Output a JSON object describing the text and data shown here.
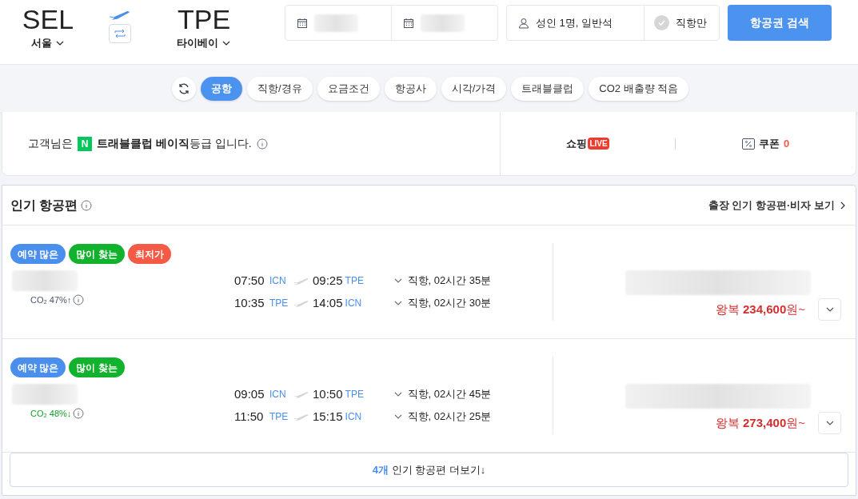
{
  "route": {
    "origin": {
      "code": "SEL",
      "city": "서울"
    },
    "destination": {
      "code": "TPE",
      "city": "타이베이"
    }
  },
  "passengers": "성인 1명, 일반석",
  "direct_only": {
    "label": "직항만",
    "checked": false
  },
  "search_button": "항공권 검색",
  "filters": [
    {
      "label": "공항",
      "selected": true
    },
    {
      "label": "직항/경유",
      "selected": false
    },
    {
      "label": "요금조건",
      "selected": false
    },
    {
      "label": "항공사",
      "selected": false
    },
    {
      "label": "시각/가격",
      "selected": false
    },
    {
      "label": "트래블클럽",
      "selected": false
    },
    {
      "label": "CO2 배출량 적음",
      "selected": false
    }
  ],
  "membership": {
    "prefix": "고객님은",
    "logo": "N",
    "text": "**트래블클럽 베이직**등급 입니다."
  },
  "shopping": {
    "label": "쇼핑",
    "badge": "LIVE"
  },
  "coupon": {
    "label": "쿠폰",
    "count": "0"
  },
  "popular": {
    "title": "인기 항공편",
    "link": "출장 인기 항공편·비자 보기",
    "flights": [
      {
        "badges": [
          {
            "label": "예약 많은",
            "color": "#4a8fec"
          },
          {
            "label": "많이 찾는",
            "color": "#13b22e"
          },
          {
            "label": "최저가",
            "color": "#f45a45"
          }
        ],
        "co2": {
          "label": "CO₂ 47%↑",
          "kind": "up"
        },
        "legs": [
          {
            "dep_time": "07:50",
            "dep": "ICN",
            "arr_time": "09:25",
            "arr": "TPE",
            "info": "직항, 02시간 35분"
          },
          {
            "dep_time": "10:35",
            "dep": "TPE",
            "arr_time": "14:05",
            "arr": "ICN",
            "info": "직항, 02시간 30분"
          }
        ],
        "price_prefix": "왕복",
        "price": "234,600",
        "price_suffix": "원~"
      },
      {
        "badges": [
          {
            "label": "예약 많은",
            "color": "#4a8fec"
          },
          {
            "label": "많이 찾는",
            "color": "#13b22e"
          }
        ],
        "co2": {
          "label": "CO₂ 48%↓",
          "kind": "down"
        },
        "legs": [
          {
            "dep_time": "09:05",
            "dep": "ICN",
            "arr_time": "10:50",
            "arr": "TPE",
            "info": "직항, 02시간 45분"
          },
          {
            "dep_time": "11:50",
            "dep": "TPE",
            "arr_time": "15:15",
            "arr": "ICN",
            "info": "직항, 02시간 25분"
          }
        ],
        "price_prefix": "왕복",
        "price": "273,400",
        "price_suffix": "원~"
      }
    ],
    "more": {
      "count": "4개",
      "text": "인기 항공편 더보기↓"
    }
  }
}
